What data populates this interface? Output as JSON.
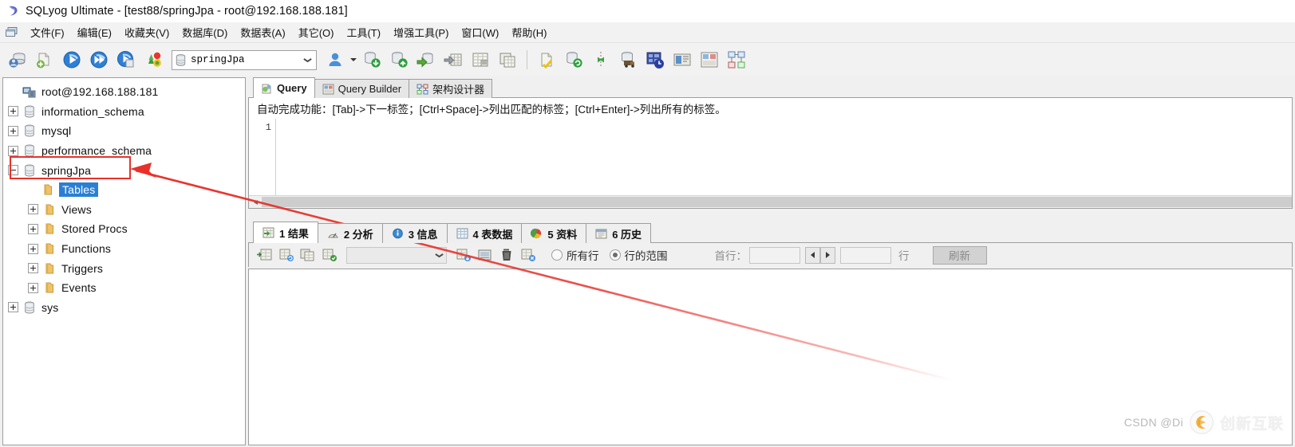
{
  "window": {
    "title": "SQLyog Ultimate - [test88/springJpa - root@192.168.188.181]",
    "logo_icon": "sqlyog-logo-icon"
  },
  "menu": {
    "icon": "window-restore-icon",
    "items": [
      {
        "label": "文件(F)",
        "name": "menu-file"
      },
      {
        "label": "编辑(E)",
        "name": "menu-edit"
      },
      {
        "label": "收藏夹(V)",
        "name": "menu-favorites"
      },
      {
        "label": "数据库(D)",
        "name": "menu-database"
      },
      {
        "label": "数据表(A)",
        "name": "menu-table"
      },
      {
        "label": "其它(O)",
        "name": "menu-other"
      },
      {
        "label": "工具(T)",
        "name": "menu-tools"
      },
      {
        "label": "增强工具(P)",
        "name": "menu-powertools"
      },
      {
        "label": "窗口(W)",
        "name": "menu-window"
      },
      {
        "label": "帮助(H)",
        "name": "menu-help"
      }
    ]
  },
  "toolbar": {
    "db_combo": {
      "value": "springJpa",
      "icon": "database-icon",
      "name": "database-selector"
    },
    "buttons_left": [
      {
        "name": "new-connection-button",
        "icon": "new-connection-icon"
      },
      {
        "name": "new-query-tab-button",
        "icon": "new-query-icon"
      },
      {
        "name": "execute-query-button",
        "icon": "execute-icon"
      },
      {
        "name": "execute-all-queries-button",
        "icon": "execute-all-icon"
      },
      {
        "name": "execute-current-query-button",
        "icon": "execute-current-icon"
      },
      {
        "name": "stop-query-button",
        "icon": "stop-query-icon"
      }
    ],
    "buttons_right": [
      {
        "name": "user-manager-button",
        "icon": "user-icon"
      },
      {
        "name": "user-manager-dropdown",
        "icon": "caret-down-icon"
      },
      {
        "name": "import-data-button",
        "icon": "database-import-icon"
      },
      {
        "name": "restore-backup-button",
        "icon": "database-restore-icon"
      },
      {
        "name": "export-data-button",
        "icon": "database-export-icon"
      },
      {
        "name": "export-grid-button",
        "icon": "grid-export-icon"
      },
      {
        "name": "table-data-button",
        "icon": "table-data-icon"
      },
      {
        "name": "copy-table-button",
        "icon": "copy-table-icon"
      },
      {
        "name": "sql-formatter-button",
        "icon": "format-sql-icon"
      },
      {
        "name": "sync-database-button",
        "icon": "database-sync-icon"
      },
      {
        "name": "data-sync-button",
        "icon": "data-sync-icon"
      },
      {
        "name": "schema-sync-button",
        "icon": "schema-sync-icon"
      },
      {
        "name": "scheduled-backup-button",
        "icon": "scheduled-backup-icon"
      },
      {
        "name": "notifications-button",
        "icon": "notification-icon"
      },
      {
        "name": "query-builder-button",
        "icon": "query-builder-icon"
      },
      {
        "name": "schema-designer-button",
        "icon": "schema-designer-icon"
      }
    ]
  },
  "tree": {
    "nodes": [
      {
        "label": "root@192.168.188.181",
        "icon": "server-icon",
        "expander": "none",
        "indent": 0,
        "name": "tree-node-server"
      },
      {
        "label": "information_schema",
        "icon": "database-icon",
        "expander": "plus",
        "indent": 0,
        "name": "tree-node-information-schema"
      },
      {
        "label": "mysql",
        "icon": "database-icon",
        "expander": "plus",
        "indent": 0,
        "name": "tree-node-mysql"
      },
      {
        "label": "performance_schema",
        "icon": "database-icon",
        "expander": "plus",
        "indent": 0,
        "name": "tree-node-performance-schema"
      },
      {
        "label": "springJpa",
        "icon": "database-icon",
        "expander": "minus",
        "indent": 0,
        "name": "tree-node-springjpa",
        "highlighted": true
      },
      {
        "label": "Tables",
        "icon": "folder-icon",
        "expander": "none",
        "indent": 1,
        "name": "tree-node-tables",
        "selected": true
      },
      {
        "label": "Views",
        "icon": "folder-icon",
        "expander": "plus",
        "indent": 1,
        "name": "tree-node-views"
      },
      {
        "label": "Stored Procs",
        "icon": "folder-icon",
        "expander": "plus",
        "indent": 1,
        "name": "tree-node-stored-procs"
      },
      {
        "label": "Functions",
        "icon": "folder-icon",
        "expander": "plus",
        "indent": 1,
        "name": "tree-node-functions"
      },
      {
        "label": "Triggers",
        "icon": "folder-icon",
        "expander": "plus",
        "indent": 1,
        "name": "tree-node-triggers"
      },
      {
        "label": "Events",
        "icon": "folder-icon",
        "expander": "plus",
        "indent": 1,
        "name": "tree-node-events"
      },
      {
        "label": "sys",
        "icon": "database-icon",
        "expander": "plus",
        "indent": 0,
        "name": "tree-node-sys"
      }
    ]
  },
  "query_tabs": [
    {
      "label": "Query",
      "icon": "query-icon",
      "active": true,
      "name": "tab-query"
    },
    {
      "label": "Query Builder",
      "icon": "query-builder-icon",
      "active": false,
      "name": "tab-query-builder"
    },
    {
      "label": "架构设计器",
      "icon": "schema-designer-icon",
      "active": false,
      "name": "tab-schema-designer"
    }
  ],
  "hint": "自动完成功能：[Tab]->下一标签；[Ctrl+Space]->列出匹配的标签；[Ctrl+Enter]->列出所有的标签。",
  "editor": {
    "line_number": "1",
    "content": ""
  },
  "result_tabs": [
    {
      "label": "1 结果",
      "icon": "result-grid-icon",
      "active": true,
      "name": "tab-result"
    },
    {
      "label": "2 分析",
      "icon": "profiler-icon",
      "active": false,
      "name": "tab-profiler"
    },
    {
      "label": "3 信息",
      "icon": "info-icon",
      "active": false,
      "name": "tab-messages"
    },
    {
      "label": "4 表数据",
      "icon": "table-data-icon",
      "active": false,
      "name": "tab-table-data"
    },
    {
      "label": "5 资料",
      "icon": "object-info-icon",
      "active": false,
      "name": "tab-object-info"
    },
    {
      "label": "6 历史",
      "icon": "history-icon",
      "active": false,
      "name": "tab-history"
    }
  ],
  "result_toolbar": {
    "buttons": [
      {
        "name": "insert-row-button",
        "icon": "insert-row-icon"
      },
      {
        "name": "duplicate-row-button",
        "icon": "duplicate-row-icon"
      },
      {
        "name": "copy-row-button",
        "icon": "copy-row-icon"
      },
      {
        "name": "save-row-button",
        "icon": "save-row-icon"
      }
    ],
    "filter_combo": {
      "value": "",
      "name": "filter-combo"
    },
    "buttons2": [
      {
        "name": "apply-filter-button",
        "icon": "apply-filter-icon"
      },
      {
        "name": "edit-blob-button",
        "icon": "edit-blob-icon"
      },
      {
        "name": "delete-row-button",
        "icon": "trash-icon"
      },
      {
        "name": "cancel-changes-button",
        "icon": "cancel-changes-icon"
      }
    ],
    "radio_all_rows": {
      "label": "所有行",
      "selected": false,
      "name": "radio-all-rows"
    },
    "radio_row_range": {
      "label": "行的范围",
      "selected": true,
      "name": "radio-row-range"
    },
    "first_row_label": "首行：",
    "first_row_value": "",
    "row_count_value": "",
    "rows_unit_label": "行",
    "refresh_label": "刷新"
  },
  "watermark": {
    "csdn": "CSDN @Di",
    "brand": "创新互联",
    "logo_icon": "cdxwl-logo-icon"
  },
  "annotation": {
    "color": "#e8312a",
    "shape": "arrow-pointing-to-springjpa"
  }
}
